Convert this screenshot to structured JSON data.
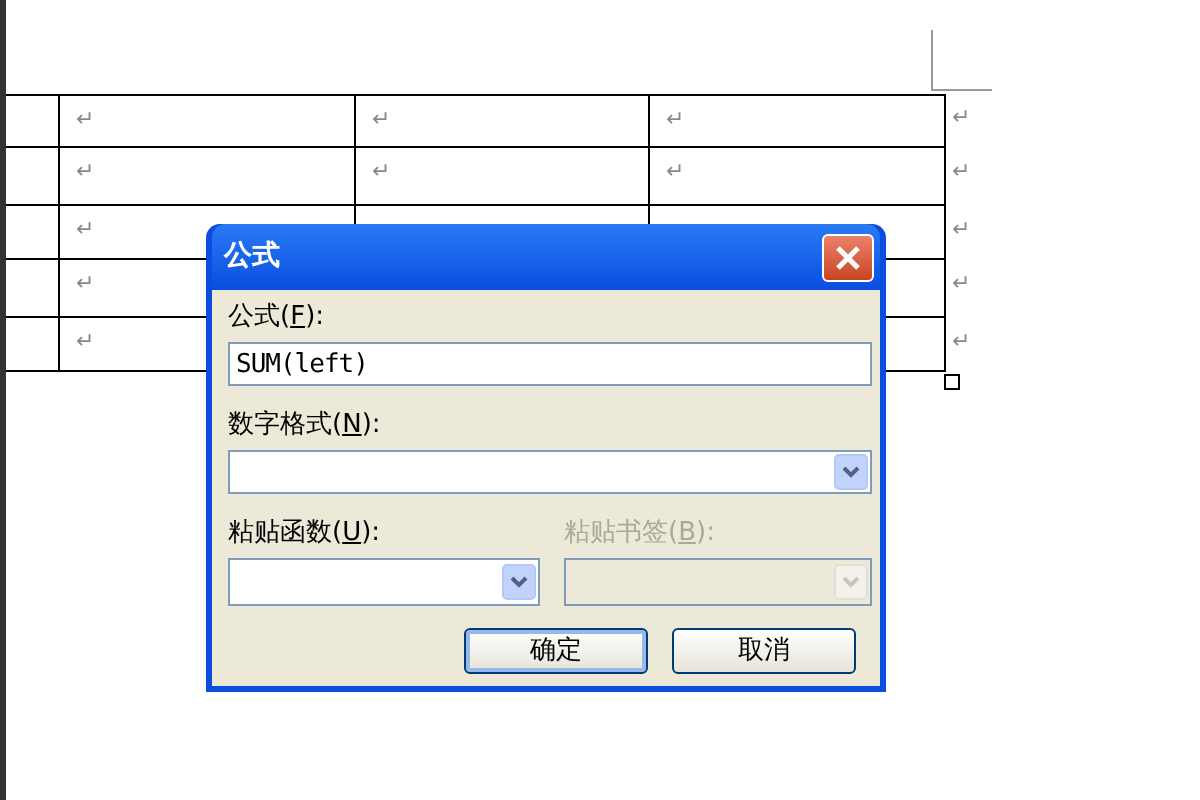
{
  "table": {
    "rows": [
      {
        "marks": [
          "↵",
          "↵",
          "↵"
        ],
        "end": "↵"
      },
      {
        "marks": [
          "↵",
          "↵",
          "↵"
        ],
        "end": "↵"
      },
      {
        "marks": [
          "↵"
        ],
        "end": "↵"
      },
      {
        "marks": [
          "↵"
        ],
        "end": "↵"
      },
      {
        "marks": [
          "↵"
        ],
        "end": "↵"
      }
    ]
  },
  "dialog": {
    "title": "公式",
    "formula": {
      "label_before": "公式(",
      "access_key": "F",
      "label_after": "):",
      "value": "SUM(left)"
    },
    "number_format": {
      "label_before": "数字格式(",
      "access_key": "N",
      "label_after": "):",
      "disabled": false
    },
    "paste_function": {
      "label_before": "粘贴函数(",
      "access_key": "U",
      "label_after": "):",
      "disabled": false
    },
    "paste_bookmark": {
      "label_before": "粘贴书签(",
      "access_key": "B",
      "label_after": "):",
      "disabled": true
    },
    "buttons": [
      {
        "label": "确定",
        "default": true
      },
      {
        "label": "取消",
        "default": false
      }
    ]
  }
}
